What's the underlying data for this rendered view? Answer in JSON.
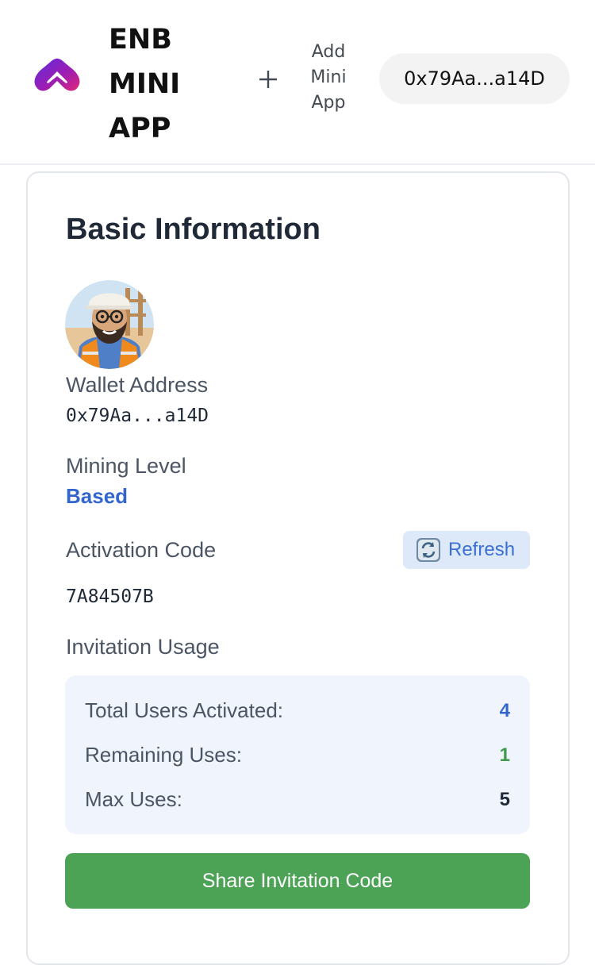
{
  "header": {
    "app_title": "ENB MINI APP",
    "logo_icon": "enb-logo-icon",
    "add_icon": "plus-icon",
    "add_label": "Add Mini App",
    "wallet_short": "0x79Aa...a14D"
  },
  "card": {
    "title": "Basic Information",
    "avatar_icon": "miner-avatar",
    "wallet_label": "Wallet Address",
    "wallet_value": "0x79Aa...a14D",
    "mining_level_label": "Mining Level",
    "mining_level_value": "Based",
    "activation_label": "Activation Code",
    "refresh_icon": "refresh-icon",
    "refresh_label": "Refresh",
    "activation_value": "7A84507B",
    "invitation_label": "Invitation Usage",
    "usage": {
      "total_label": "Total Users Activated:",
      "total_value": "4",
      "remaining_label": "Remaining Uses:",
      "remaining_value": "1",
      "max_label": "Max Uses:",
      "max_value": "5"
    },
    "share_label": "Share Invitation Code"
  },
  "colors": {
    "accent_blue": "#3366cc",
    "accent_green": "#4ca356",
    "usage_bg": "#eff4fd",
    "refresh_bg": "#dde8f8"
  }
}
